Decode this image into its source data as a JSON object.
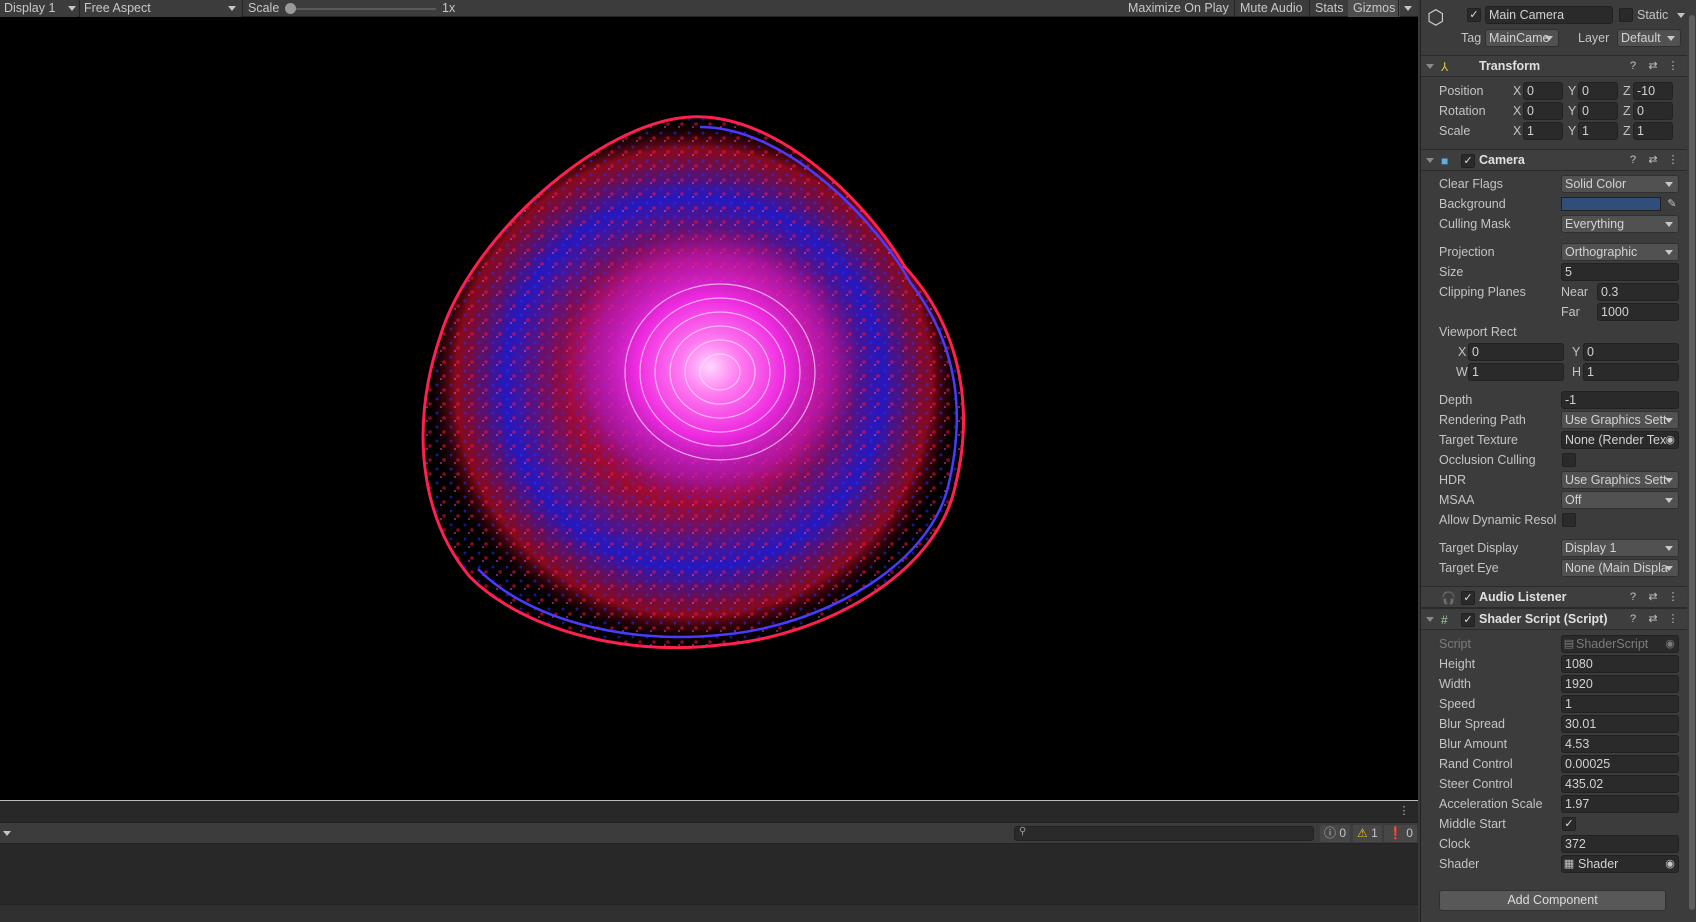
{
  "game_toolbar": {
    "display": "Display 1",
    "aspect": "Free Aspect",
    "scale_label": "Scale",
    "scale_value": "1x",
    "maximize": "Maximize On Play",
    "mute": "Mute Audio",
    "stats": "Stats",
    "gizmos": "Gizmos"
  },
  "console": {
    "log_count": "0",
    "warn_count": "1",
    "error_count": "0"
  },
  "inspector": {
    "object_name": "Main Camera",
    "static_label": "Static",
    "tag_label": "Tag",
    "tag_value": "MainCame",
    "layer_label": "Layer",
    "layer_value": "Default",
    "transform": {
      "title": "Transform",
      "position": {
        "label": "Position",
        "x": "0",
        "y": "0",
        "z": "-10"
      },
      "rotation": {
        "label": "Rotation",
        "x": "0",
        "y": "0",
        "z": "0"
      },
      "scale": {
        "label": "Scale",
        "x": "1",
        "y": "1",
        "z": "1"
      }
    },
    "camera": {
      "title": "Camera",
      "clear_flags_label": "Clear Flags",
      "clear_flags": "Solid Color",
      "background_label": "Background",
      "background_color": "#314d79",
      "culling_mask_label": "Culling Mask",
      "culling_mask": "Everything",
      "projection_label": "Projection",
      "projection": "Orthographic",
      "size_label": "Size",
      "size": "5",
      "clipping_label": "Clipping Planes",
      "near_label": "Near",
      "near": "0.3",
      "far_label": "Far",
      "far": "1000",
      "viewport_label": "Viewport Rect",
      "vx": "0",
      "vy": "0",
      "vw": "1",
      "vh": "1",
      "depth_label": "Depth",
      "depth": "-1",
      "rendering_path_label": "Rendering Path",
      "rendering_path": "Use Graphics Sett",
      "target_texture_label": "Target Texture",
      "target_texture": "None (Render Tex",
      "occlusion_label": "Occlusion Culling",
      "hdr_label": "HDR",
      "hdr": "Use Graphics Sett",
      "msaa_label": "MSAA",
      "msaa": "Off",
      "dynres_label": "Allow Dynamic Resol",
      "target_display_label": "Target Display",
      "target_display": "Display 1",
      "target_eye_label": "Target Eye",
      "target_eye": "None (Main Displa"
    },
    "audio_listener": {
      "title": "Audio Listener"
    },
    "shader_script": {
      "title": "Shader Script (Script)",
      "script_label": "Script",
      "script": "ShaderScript",
      "height_label": "Height",
      "height": "1080",
      "width_label": "Width",
      "width": "1920",
      "speed_label": "Speed",
      "speed": "1",
      "blur_spread_label": "Blur Spread",
      "blur_spread": "30.01",
      "blur_amount_label": "Blur Amount",
      "blur_amount": "4.53",
      "rand_control_label": "Rand Control",
      "rand_control": "0.00025",
      "steer_control_label": "Steer Control",
      "steer_control": "435.02",
      "accel_scale_label": "Acceleration Scale",
      "accel_scale": "1.97",
      "middle_start_label": "Middle Start",
      "clock_label": "Clock",
      "clock": "372",
      "shader_label": "Shader",
      "shader": "Shader"
    },
    "add_component": "Add Component"
  }
}
